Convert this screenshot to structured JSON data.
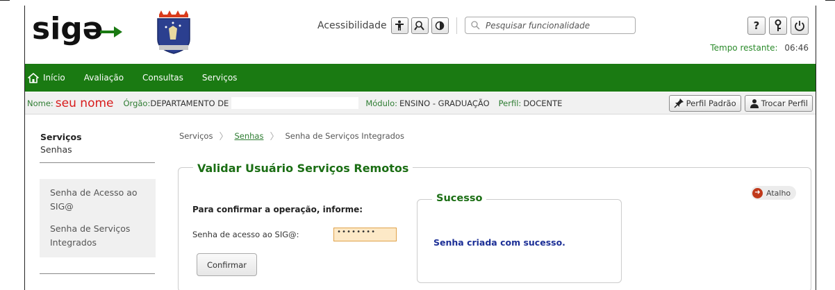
{
  "header": {
    "logo_text": "sigə",
    "accessibility_label": "Acessibilidade",
    "search_placeholder": "Pesquisar funcionalidade",
    "help_glyph": "?",
    "timer_label": "Tempo restante:",
    "timer_value": "06:46"
  },
  "nav": {
    "items": [
      "Início",
      "Avaliação",
      "Consultas",
      "Serviços"
    ]
  },
  "info": {
    "nome_label": "Nome:",
    "nome_value": "seu nome",
    "orgao_label": "Órgão:",
    "orgao_value": "DEPARTAMENTO DE",
    "modulo_label": "Módulo:",
    "modulo_value": "ENSINO - GRADUAÇÃO",
    "perfil_label": "Perfil:",
    "perfil_value": "DOCENTE",
    "perfil_padrao": "Perfil Padrão",
    "trocar_perfil": "Trocar Perfil"
  },
  "sidebar": {
    "title": "Serviços",
    "subtitle": "Senhas",
    "items": [
      "Senha de Acesso ao SIG@",
      "Senha de Serviços Integrados"
    ]
  },
  "breadcrumb": [
    "Serviços",
    "Senhas",
    "Senha de Serviços Integrados"
  ],
  "form": {
    "title": "Validar Usuário Serviços Remotos",
    "instruction": "Para confirmar a operação, informe:",
    "password_label": "Senha de acesso ao SIG@:",
    "password_value": "••••••••",
    "confirm_button": "Confirmar"
  },
  "result": {
    "title": "Sucesso",
    "message": "Senha criada com sucesso.",
    "atalho": "Atalho"
  },
  "colors": {
    "nav_green": "#1a7a12",
    "title_green": "#1b6e14",
    "name_red": "#d81b1b",
    "success_blue": "#1c2f96"
  }
}
